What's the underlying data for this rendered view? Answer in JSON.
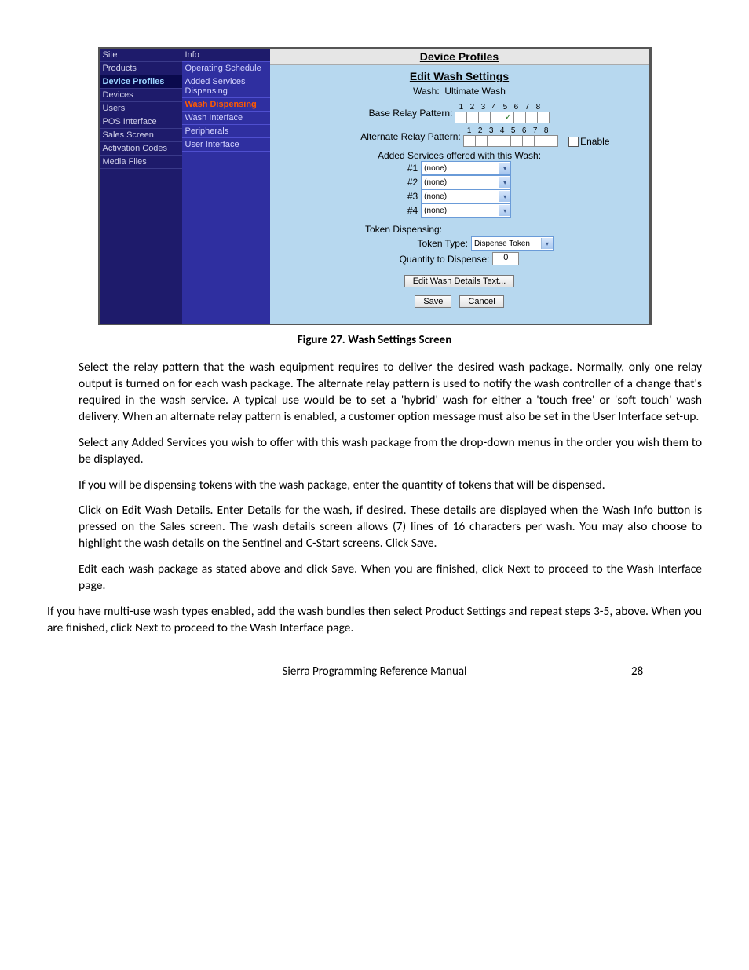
{
  "sidebar1": {
    "items": [
      "Site",
      "Products",
      "Device Profiles",
      "Devices",
      "Users",
      "POS Interface",
      "Sales Screen",
      "Activation Codes",
      "Media Files"
    ],
    "active_index": 2
  },
  "sidebar2": {
    "items": [
      "Info",
      "Operating Schedule",
      "Added Services Dispensing",
      "Wash Dispensing",
      "Wash Interface",
      "Peripherals",
      "User Interface"
    ],
    "active_index": 3
  },
  "panel": {
    "header": "Device Profiles",
    "subtitle": "Edit Wash Settings",
    "wash_label": "Wash:",
    "wash_value": "Ultimate Wash",
    "base_relay_label": "Base Relay Pattern:",
    "alt_relay_label": "Alternate Relay Pattern:",
    "relay_numbers": [
      "1",
      "2",
      "3",
      "4",
      "5",
      "6",
      "7",
      "8"
    ],
    "base_checked_index": 4,
    "enable_label": "Enable",
    "offered_label": "Added Services offered with this Wash:",
    "services": [
      {
        "label": "#1",
        "value": "(none)"
      },
      {
        "label": "#2",
        "value": "(none)"
      },
      {
        "label": "#3",
        "value": "(none)"
      },
      {
        "label": "#4",
        "value": "(none)"
      }
    ],
    "token_section": "Token Dispensing:",
    "token_type_label": "Token Type:",
    "token_type_value": "Dispense Token",
    "qty_label": "Quantity to Dispense:",
    "qty_value": "0",
    "edit_details_button": "Edit Wash Details Text...",
    "save_button": "Save",
    "cancel_button": "Cancel"
  },
  "figure_caption": "Figure 27. Wash Settings Screen",
  "paragraphs": {
    "p1": "Select the relay pattern that the wash equipment requires to deliver the desired wash package. Normally, only one relay output is turned on for each wash package. The alternate relay pattern is used to notify the wash controller of a change that's required in the wash service. A typical use would be to set a 'hybrid' wash for either a 'touch free' or 'soft touch' wash delivery. When an alternate relay pattern is enabled, a customer option message must also be set in the User Interface set-up.",
    "p2": "Select any Added Services you wish to offer with this wash package from the drop-down menus in the order you wish them to be displayed.",
    "p3": "If you will be dispensing tokens with the wash package, enter the quantity of tokens that will be dispensed.",
    "p4": "Click on Edit Wash Details. Enter Details for the wash, if desired. These details are displayed when the Wash Info button is pressed on the Sales screen. The wash details screen allows (7) lines of 16 characters per wash. You may also choose to highlight the wash details on the Sentinel and C-Start screens. Click Save.",
    "p5": "Edit each wash package as stated above and click Save. When you are finished, click Next to proceed to the Wash Interface page.",
    "p6": "If you have multi-use wash types enabled, add the wash bundles then select Product Settings and repeat steps 3-5, above. When you are finished, click Next to proceed to the Wash Interface page."
  },
  "footer": {
    "title": "Sierra Programming Reference Manual",
    "page": "28"
  }
}
